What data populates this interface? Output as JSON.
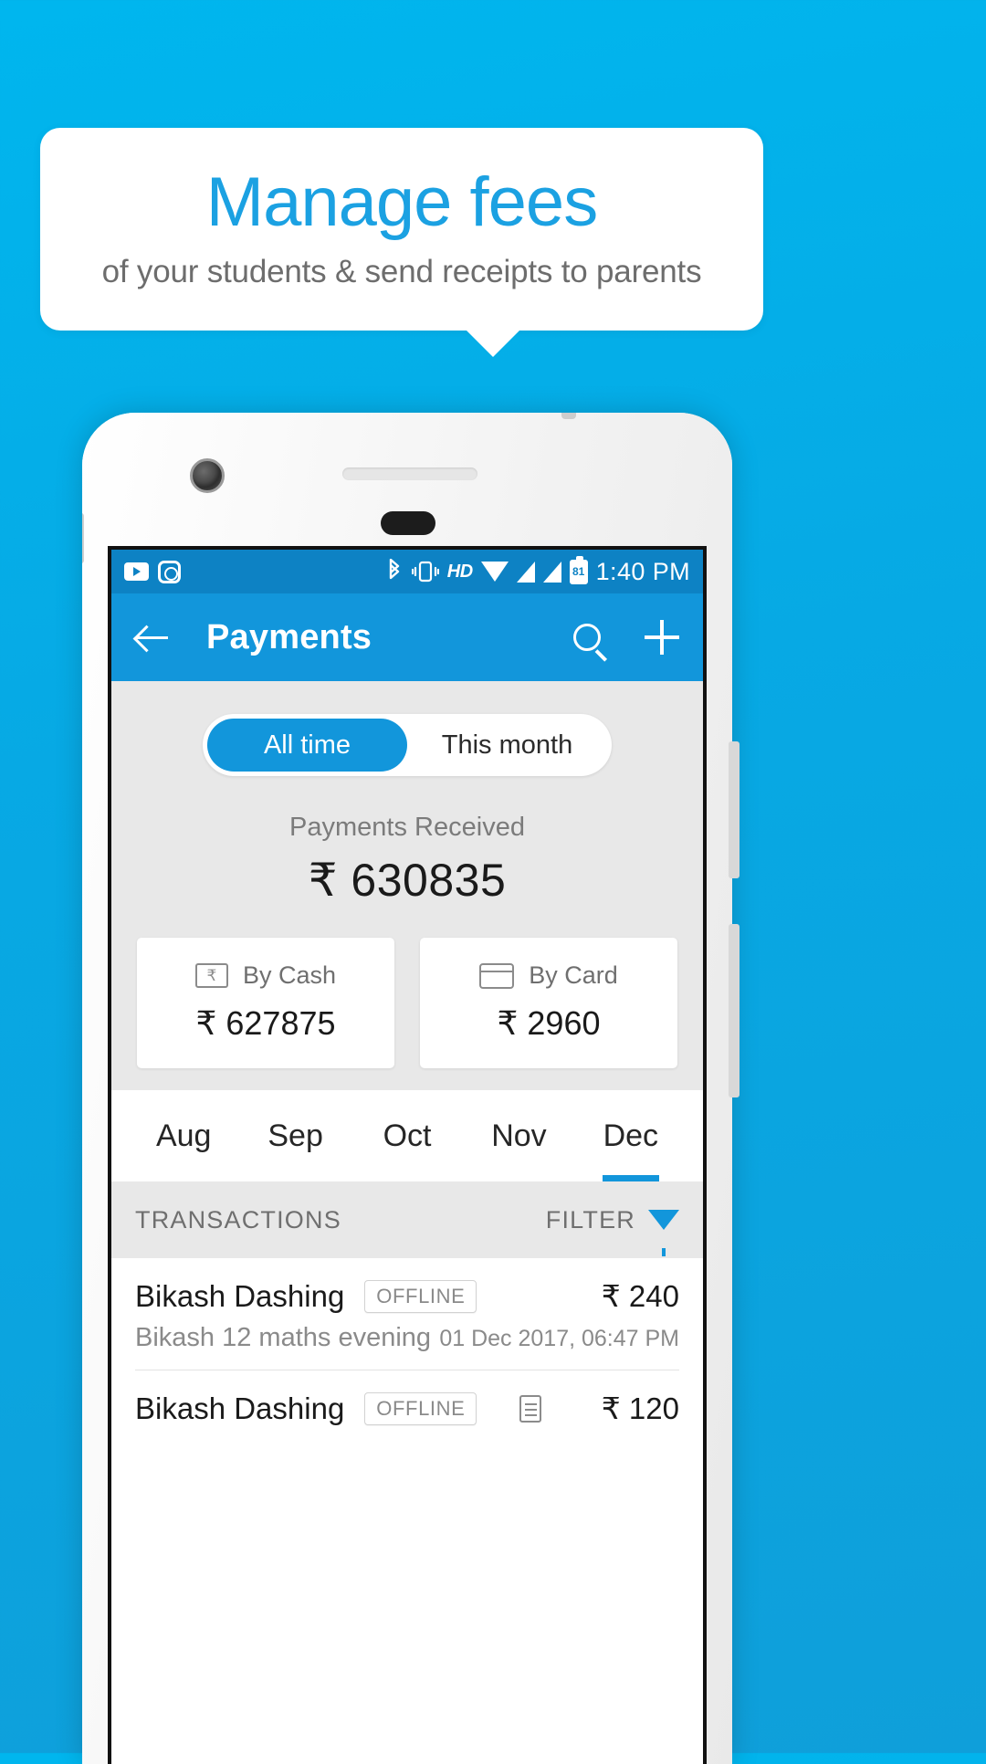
{
  "promo": {
    "title": "Manage fees",
    "subtitle": "of your students & send receipts to parents"
  },
  "status_bar": {
    "icons": [
      "youtube-icon",
      "camera-icon",
      "bluetooth-icon",
      "vibrate-icon",
      "hd-icon",
      "wifi-icon",
      "signal-icon",
      "signal-icon"
    ],
    "hd_label": "HD",
    "battery_level": "81",
    "time": "1:40 PM"
  },
  "app_bar": {
    "back_label": "back-arrow",
    "title": "Payments",
    "search_label": "search",
    "add_label": "add"
  },
  "segmented": {
    "options": [
      "All time",
      "This month"
    ],
    "selected": "All time"
  },
  "summary": {
    "received_label": "Payments Received",
    "received_amount": "₹ 630835",
    "cards": [
      {
        "icon": "rupee-note-icon",
        "label": "By Cash",
        "amount": "₹ 627875"
      },
      {
        "icon": "credit-card-icon",
        "label": "By Card",
        "amount": "₹ 2960"
      }
    ]
  },
  "months": {
    "tabs": [
      "Aug",
      "Sep",
      "Oct",
      "Nov",
      "Dec"
    ],
    "selected": "Dec"
  },
  "transactions_header": {
    "title": "TRANSACTIONS",
    "filter_label": "FILTER"
  },
  "transactions": [
    {
      "name": "Bikash Dashing",
      "badge": "OFFLINE",
      "amount": "₹ 240",
      "description": "Bikash 12 maths evening",
      "date": "01 Dec 2017, 06:47 PM",
      "has_receipt": false
    },
    {
      "name": "Bikash Dashing",
      "badge": "OFFLINE",
      "amount": "₹ 120",
      "description": "",
      "date": "",
      "has_receipt": true
    }
  ],
  "colors": {
    "brand": "#1296db",
    "status_bar": "#0d82c4",
    "background": "#00b6ee",
    "surface": "#e8e8e8"
  }
}
